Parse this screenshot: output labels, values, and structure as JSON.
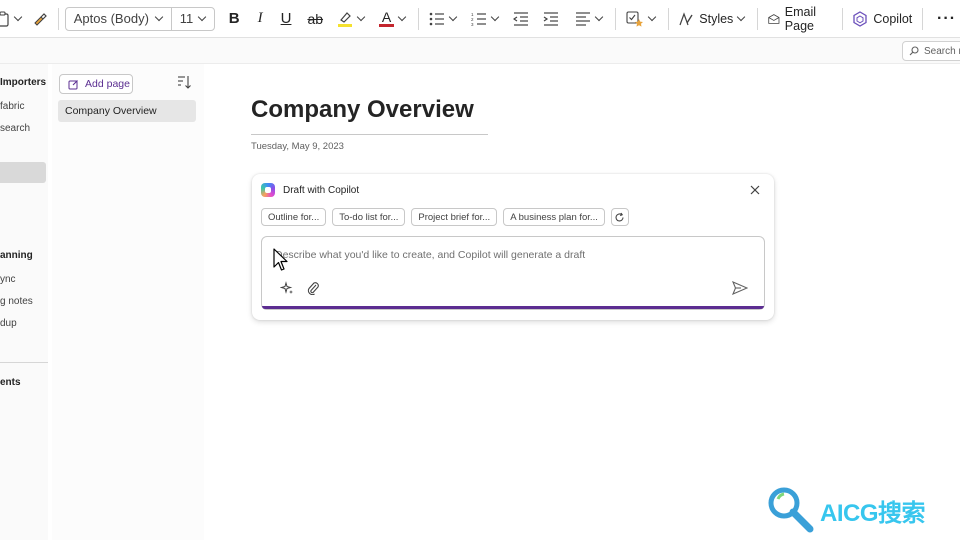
{
  "ribbon": {
    "font_name": "Aptos (Body)",
    "font_size": "11",
    "bold": "B",
    "italic": "I",
    "underline": "U",
    "strike": "ab",
    "font_color_glyph": "A",
    "highlight_color": "#f5e12e",
    "font_color": "#c4262e",
    "styles_label": "Styles",
    "email_label": "Email Page",
    "copilot_label": "Copilot",
    "more_glyph": "···"
  },
  "search": {
    "placeholder": "Search n"
  },
  "left_nav": {
    "items": [
      "Importers",
      "fabric",
      "search",
      "anning",
      "ync",
      "g notes",
      "dup",
      "ents"
    ]
  },
  "page_list": {
    "add_page_label": "Add page",
    "pages": [
      "Company Overview"
    ]
  },
  "canvas": {
    "title": "Company Overview",
    "date": "Tuesday, May 9, 2023"
  },
  "copilot": {
    "title": "Draft with Copilot",
    "chips": [
      "Outline for...",
      "To-do list for...",
      "Project brief for...",
      "A business plan for..."
    ],
    "placeholder": "Describe what you'd like to create, and Copilot will generate a draft",
    "accent": "#5c2d91"
  },
  "watermark": {
    "text": "AICG搜索"
  }
}
